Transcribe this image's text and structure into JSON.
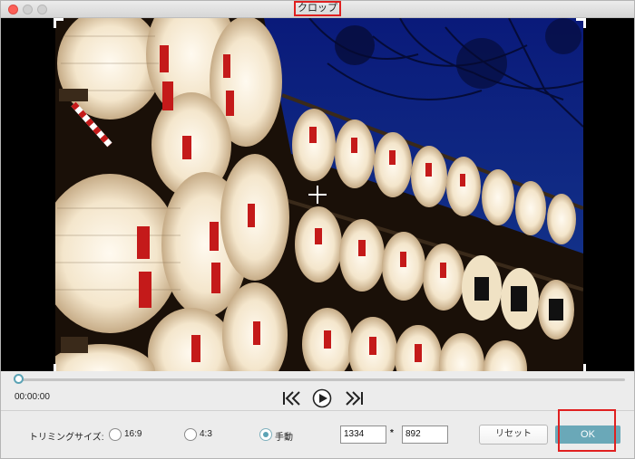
{
  "window": {
    "title": "クロップ"
  },
  "player": {
    "time": "00:00:00",
    "progress": 0
  },
  "controls": {
    "prev_icon": "skip-back-icon",
    "play_icon": "play-circle-icon",
    "next_icon": "skip-forward-icon"
  },
  "trim": {
    "label": "トリミングサイズ:",
    "options": [
      {
        "label": "16:9",
        "checked": false
      },
      {
        "label": "4:3",
        "checked": false
      },
      {
        "label": "手動",
        "checked": true
      }
    ],
    "width": "1334",
    "separator": "*",
    "height": "892"
  },
  "buttons": {
    "reset": "リセット",
    "ok": "OK"
  },
  "colors": {
    "accent": "#6aa8b8",
    "highlight": "#e02020",
    "close": "#fc5f57"
  }
}
